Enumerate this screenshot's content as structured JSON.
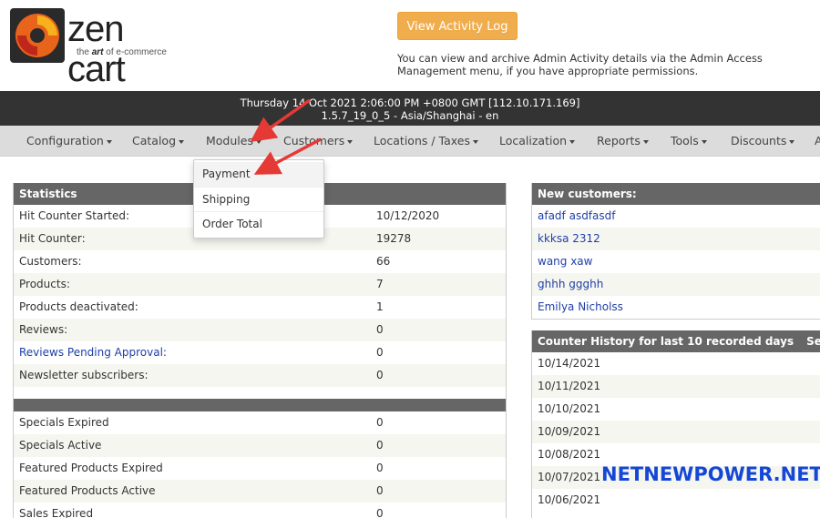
{
  "logo": {
    "name": "zen cart",
    "tagline_pre": "the ",
    "tagline_art": "art",
    "tagline_post": " of e-commerce"
  },
  "activity": {
    "button_label": "View Activity Log",
    "note": "You can view and archive Admin Activity details via the Admin Access Management menu, if you have appropriate permissions."
  },
  "topbar": {
    "line1": "Thursday 14 Oct 2021 2:06:00 PM +0800 GMT [112.10.171.169]",
    "line2": "1.5.7_19_0_5 - Asia/Shanghai - en"
  },
  "nav": [
    {
      "label": "Configuration"
    },
    {
      "label": "Catalog"
    },
    {
      "label": "Modules"
    },
    {
      "label": "Customers"
    },
    {
      "label": "Locations / Taxes"
    },
    {
      "label": "Localization"
    },
    {
      "label": "Reports"
    },
    {
      "label": "Tools"
    },
    {
      "label": "Discounts"
    },
    {
      "label": "A"
    }
  ],
  "modules_menu": [
    {
      "label": "Payment"
    },
    {
      "label": "Shipping"
    },
    {
      "label": "Order Total"
    }
  ],
  "statistics": {
    "title": "Statistics",
    "rows": [
      {
        "label": "Hit Counter Started:",
        "value": "10/12/2020"
      },
      {
        "label": "Hit Counter:",
        "value": "19278"
      },
      {
        "label": "Customers:",
        "value": "66"
      },
      {
        "label": "Products:",
        "value": "7"
      },
      {
        "label": "Products deactivated:",
        "value": "1"
      },
      {
        "label": "Reviews:",
        "value": "0"
      },
      {
        "label": "Reviews Pending Approval:",
        "value": "0"
      },
      {
        "label": "Newsletter subscribers:",
        "value": "0"
      }
    ],
    "rows2": [
      {
        "label": "Specials Expired",
        "value": "0"
      },
      {
        "label": "Specials Active",
        "value": "0"
      },
      {
        "label": "Featured Products Expired",
        "value": "0"
      },
      {
        "label": "Featured Products Active",
        "value": "0"
      },
      {
        "label": "Sales Expired",
        "value": "0"
      }
    ]
  },
  "new_customers": {
    "title": "New customers:",
    "items": [
      "afadf asdfasdf",
      "kkksa 2312",
      "wang xaw",
      "ghhh ggghh",
      "Emilya Nicholss"
    ]
  },
  "counter_history": {
    "title": "Counter History for last 10 recorded days",
    "col2": "Session",
    "dates": [
      "10/14/2021",
      "10/11/2021",
      "10/10/2021",
      "10/09/2021",
      "10/08/2021",
      "10/07/2021",
      "10/06/2021"
    ]
  },
  "watermark": "NETNEWPOWER.NET",
  "colors": {
    "accent_button": "#f0ad4e",
    "header_bar": "#333333",
    "panel_head": "#666666",
    "arrow": "#e53935",
    "watermark": "#1447d6"
  }
}
